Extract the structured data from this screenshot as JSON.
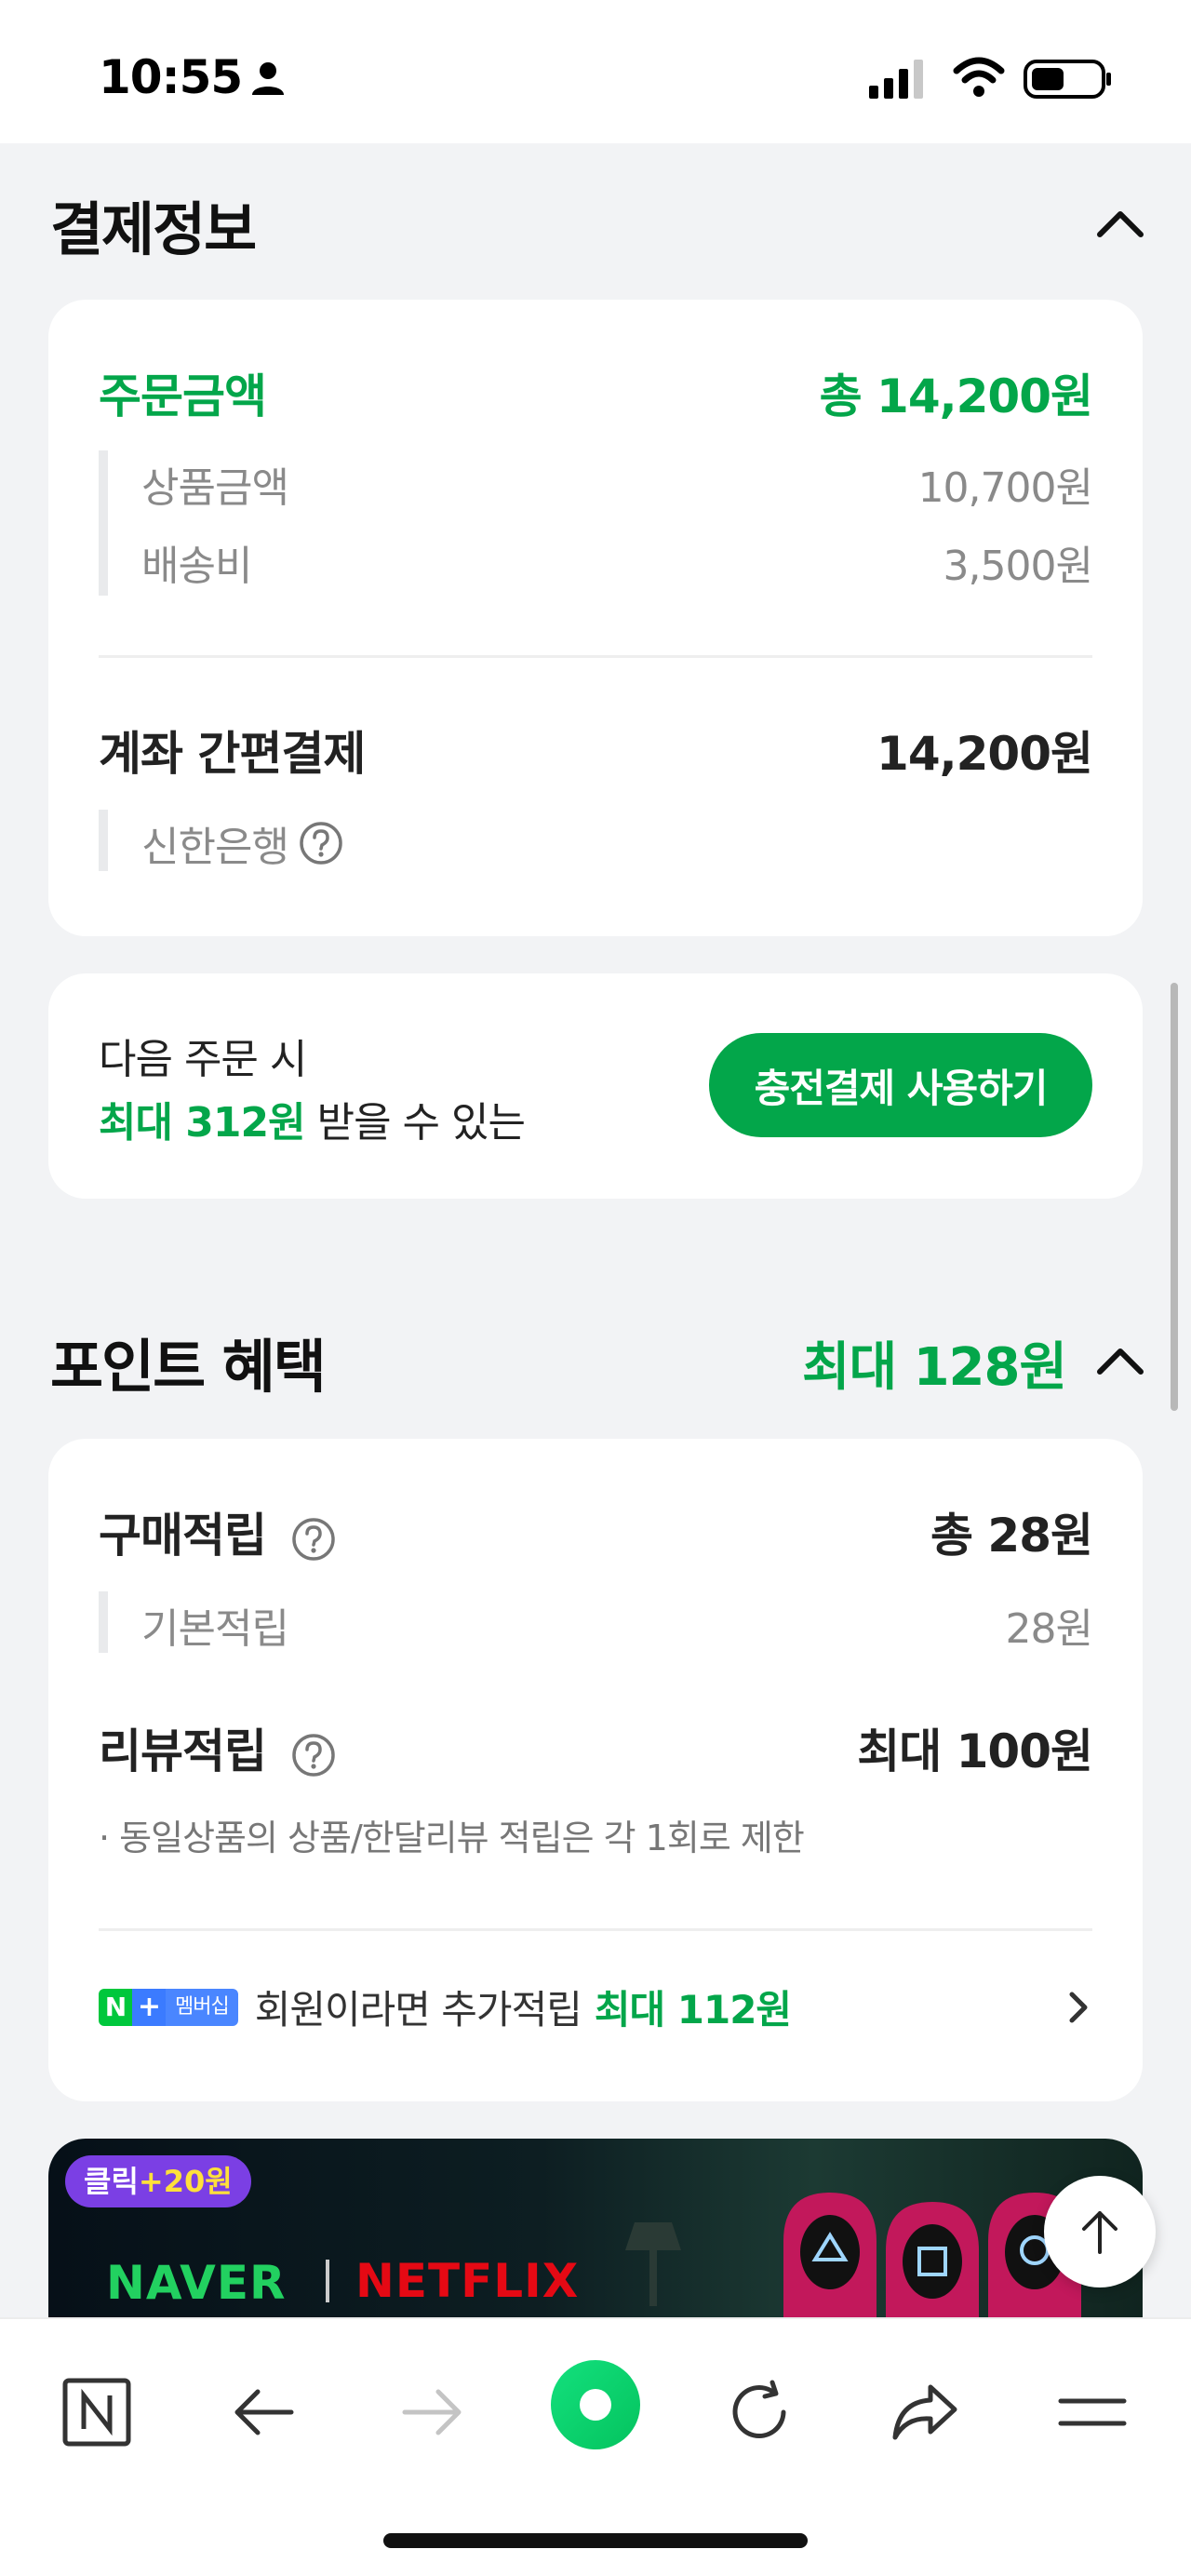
{
  "status_bar": {
    "time": "10:55"
  },
  "payment": {
    "section_title": "결제정보",
    "order_label": "주문금액",
    "order_total": "총 14,200원",
    "items": [
      {
        "label": "상품금액",
        "value": "10,700원"
      },
      {
        "label": "배송비",
        "value": "3,500원"
      }
    ],
    "method_label": "계좌 간편결제",
    "method_amount": "14,200원",
    "bank": "신한은행"
  },
  "promo": {
    "line1": "다음 주문 시",
    "line2_highlight": "최대 312원",
    "line2_rest": " 받을 수 있는",
    "button": "충전결제 사용하기"
  },
  "points": {
    "section_title": "포인트 혜택",
    "max": "최대 128원",
    "purchase_label": "구매적립",
    "purchase_total": "총 28원",
    "purchase_sub": {
      "label": "기본적립",
      "value": "28원"
    },
    "review_label": "리뷰적립",
    "review_max": "최대 100원",
    "review_note": "· 동일상품의 상품/한달리뷰 적립은 각 1회로 제한",
    "membership_badge": {
      "n": "N",
      "plus": "+",
      "text": "멤버십"
    },
    "membership_text": "회원이라면 추가적립 ",
    "membership_highlight": "최대 112원"
  },
  "banner": {
    "chip_prefix": "클릭",
    "chip_bonus": "+20원",
    "brand1": "NAVER",
    "brand2": "NETFLIX"
  },
  "colors": {
    "accent_green": "#03a64a",
    "background": "#f2f3f5",
    "card": "#ffffff"
  },
  "icons": [
    "person-icon",
    "signal-icon",
    "wifi-icon",
    "battery-icon",
    "chevron-up-icon",
    "question-icon",
    "chevron-right-icon",
    "arrow-up-icon",
    "naver-n-icon",
    "back-arrow-icon",
    "forward-arrow-icon",
    "green-dot-icon",
    "refresh-icon",
    "share-icon",
    "menu-icon"
  ]
}
